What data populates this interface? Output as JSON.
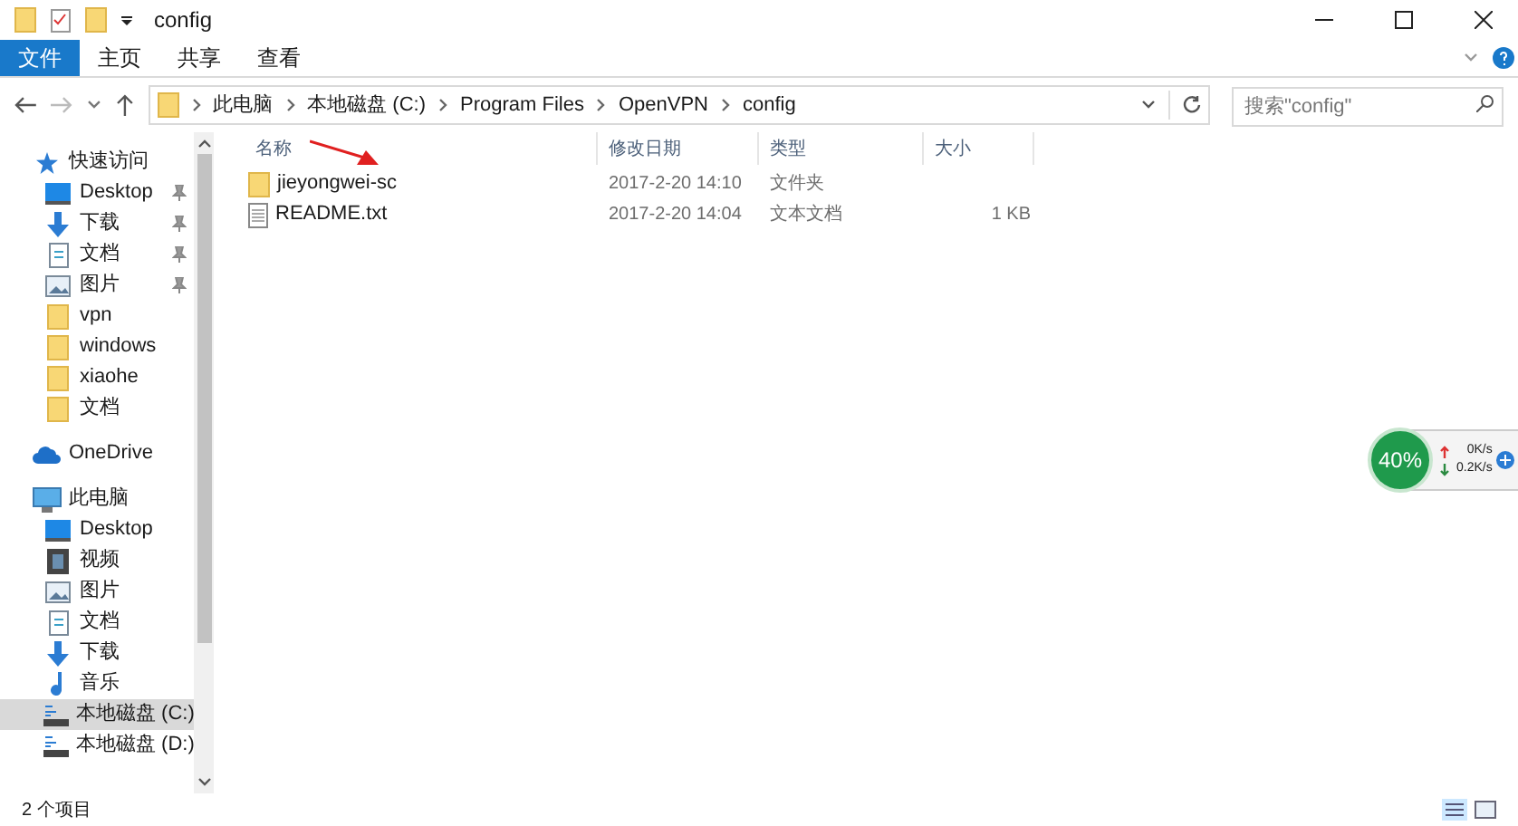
{
  "window": {
    "title": "config"
  },
  "ribbon": {
    "tabs": [
      {
        "label": "文件",
        "kind": "file",
        "selected": false
      },
      {
        "label": "主页",
        "kind": "tab",
        "selected": false
      },
      {
        "label": "共享",
        "kind": "tab",
        "selected": false
      },
      {
        "label": "查看",
        "kind": "tab",
        "selected": false
      }
    ]
  },
  "address_bar": {
    "path": [
      "此电脑",
      "本地磁盘 (C:)",
      "Program Files",
      "OpenVPN",
      "config"
    ],
    "search": {
      "placeholder": "搜索\"config\""
    }
  },
  "sidebar": {
    "items": [
      {
        "label": "快速访问",
        "kind": "star",
        "selected": false,
        "children": [
          {
            "label": "Desktop",
            "kind": "desktop",
            "pinned": true,
            "selected": false
          },
          {
            "label": "下载",
            "kind": "download",
            "pinned": true,
            "selected": false
          },
          {
            "label": "文档",
            "kind": "document",
            "pinned": true,
            "selected": false
          },
          {
            "label": "图片",
            "kind": "picture",
            "pinned": true,
            "selected": false
          },
          {
            "label": "vpn",
            "kind": "folder",
            "pinned": false,
            "selected": false
          },
          {
            "label": "windows",
            "kind": "folder",
            "pinned": false,
            "selected": false
          },
          {
            "label": "xiaohe",
            "kind": "folder",
            "pinned": false,
            "selected": false
          },
          {
            "label": "文档",
            "kind": "folder",
            "pinned": false,
            "selected": false
          }
        ]
      },
      {
        "label": "OneDrive",
        "kind": "cloud",
        "selected": false
      },
      {
        "label": "此电脑",
        "kind": "computer",
        "selected": false,
        "children": [
          {
            "label": "Desktop",
            "kind": "desktop",
            "pinned": false,
            "selected": false
          },
          {
            "label": "视频",
            "kind": "video",
            "pinned": false,
            "selected": false
          },
          {
            "label": "图片",
            "kind": "picture",
            "pinned": false,
            "selected": false
          },
          {
            "label": "文档",
            "kind": "document",
            "pinned": false,
            "selected": false
          },
          {
            "label": "下载",
            "kind": "download",
            "pinned": false,
            "selected": false
          },
          {
            "label": "音乐",
            "kind": "music",
            "pinned": false,
            "selected": false
          },
          {
            "label": "本地磁盘 (C:)",
            "kind": "drive",
            "pinned": false,
            "selected": true
          },
          {
            "label": "本地磁盘 (D:)",
            "kind": "drive",
            "pinned": false,
            "selected": false
          }
        ]
      }
    ]
  },
  "file_list": {
    "columns": [
      "名称",
      "修改日期",
      "类型",
      "大小"
    ],
    "rows": [
      {
        "name": "jieyongwei-sc",
        "modified": "2017-2-20 14:10",
        "type": "文件夹",
        "kind": "folder"
      },
      {
        "name": "README.txt",
        "modified": "2017-2-20 14:04",
        "type": "文本文档",
        "size": "1 KB",
        "kind": "text"
      }
    ]
  },
  "speed_widget": {
    "percent": "40%",
    "upload": "0K/s",
    "download": "0.2K/s"
  },
  "status_bar": {
    "count": "2 个项目"
  }
}
